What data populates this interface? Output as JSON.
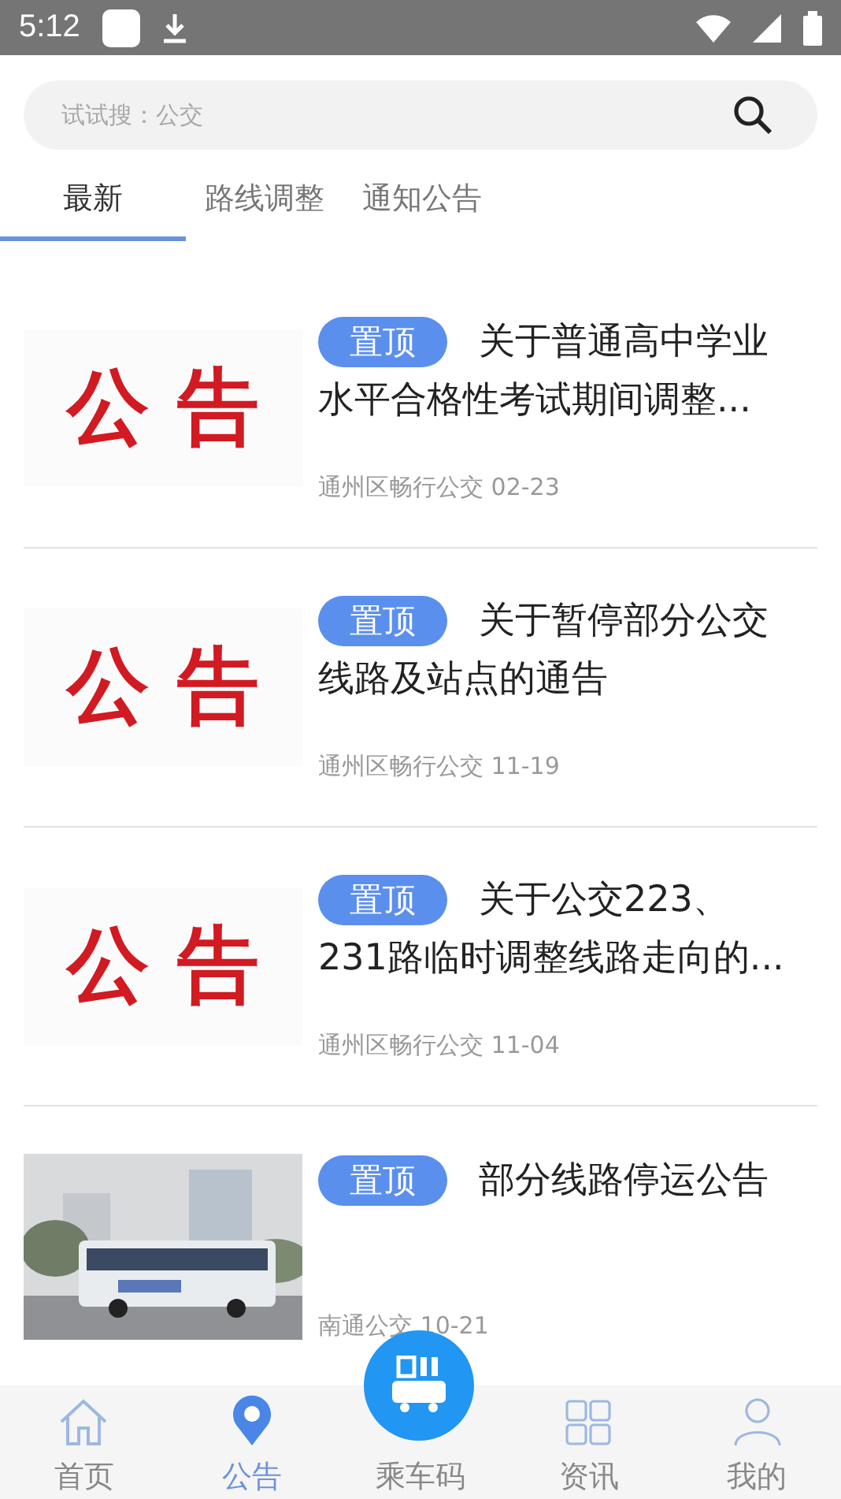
{
  "status_bar": {
    "time": "5:12"
  },
  "search": {
    "placeholder": "试试搜：公交"
  },
  "tabs": [
    {
      "label": "最新",
      "selected": true
    },
    {
      "label": "路线调整",
      "selected": false
    },
    {
      "label": "通知公告",
      "selected": false
    }
  ],
  "items": [
    {
      "thumb": {
        "kind": "notice",
        "text": "公 告"
      },
      "badge": "置顶",
      "title": "关于普通高中学业水平合格性考试期间调整...",
      "source": "通州区畅行公交",
      "date": "02-23"
    },
    {
      "thumb": {
        "kind": "notice",
        "text": "公 告"
      },
      "badge": "置顶",
      "title": "关于暂停部分公交线路及站点的通告",
      "source": "通州区畅行公交",
      "date": "11-19"
    },
    {
      "thumb": {
        "kind": "notice",
        "text": "公 告"
      },
      "badge": "置顶",
      "title": "关于公交223、231路临时调整线路走向的...",
      "source": "通州区畅行公交",
      "date": "11-04"
    },
    {
      "badge": "置顶",
      "title": "部分线路停运公告",
      "source": "南通公交",
      "date": "10-21"
    }
  ],
  "nav": [
    {
      "label": "首页",
      "kind": "home",
      "selected": false
    },
    {
      "label": "公告",
      "kind": "pin",
      "selected": true
    },
    {
      "label": "乘车码",
      "kind": "bus",
      "selected": false
    },
    {
      "label": "资讯",
      "kind": "grid",
      "selected": false
    },
    {
      "label": "我的",
      "kind": "user",
      "selected": false
    }
  ]
}
